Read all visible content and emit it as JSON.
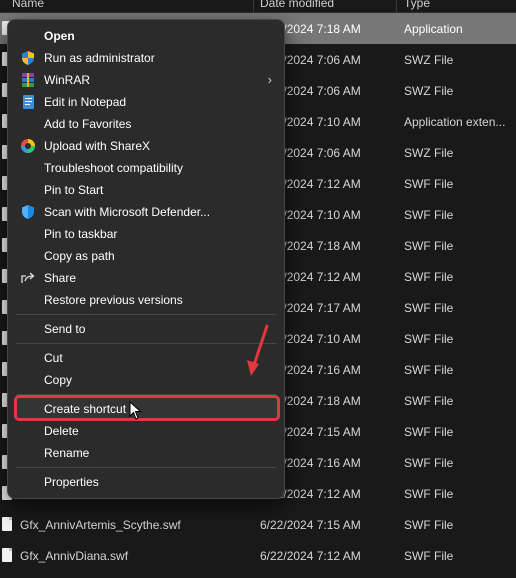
{
  "columns": {
    "name": "Name",
    "date": "Date modified",
    "type": "Type"
  },
  "rows": [
    {
      "name": "",
      "date": "6/22/2024 7:18 AM",
      "type": "Application",
      "selected": true
    },
    {
      "name": "",
      "date": "6/22/2024 7:06 AM",
      "type": "SWZ File"
    },
    {
      "name": "",
      "date": "6/22/2024 7:06 AM",
      "type": "SWZ File"
    },
    {
      "name": "",
      "date": "6/22/2024 7:10 AM",
      "type": "Application exten..."
    },
    {
      "name": "",
      "date": "6/22/2024 7:06 AM",
      "type": "SWZ File"
    },
    {
      "name": "",
      "date": "6/22/2024 7:12 AM",
      "type": "SWF File"
    },
    {
      "name": "",
      "date": "6/22/2024 7:10 AM",
      "type": "SWF File"
    },
    {
      "name": "",
      "date": "6/22/2024 7:18 AM",
      "type": "SWF File"
    },
    {
      "name": "",
      "date": "6/22/2024 7:12 AM",
      "type": "SWF File"
    },
    {
      "name": "",
      "date": "6/22/2024 7:17 AM",
      "type": "SWF File"
    },
    {
      "name": "",
      "date": "6/22/2024 7:10 AM",
      "type": "SWF File"
    },
    {
      "name": "",
      "date": "6/22/2024 7:16 AM",
      "type": "SWF File"
    },
    {
      "name": "",
      "date": "6/22/2024 7:18 AM",
      "type": "SWF File"
    },
    {
      "name": "",
      "date": "6/22/2024 7:15 AM",
      "type": "SWF File"
    },
    {
      "name": "",
      "date": "6/22/2024 7:16 AM",
      "type": "SWF File"
    },
    {
      "name": "",
      "date": "6/22/2024 7:12 AM",
      "type": "SWF File"
    },
    {
      "name": "Gfx_AnnivArtemis_Scythe.swf",
      "date": "6/22/2024 7:15 AM",
      "type": "SWF File"
    },
    {
      "name": "Gfx_AnnivDiana.swf",
      "date": "6/22/2024 7:12 AM",
      "type": "SWF File"
    }
  ],
  "menu": {
    "items": [
      {
        "label": "Open",
        "icon": "none",
        "bold": true
      },
      {
        "label": "Run as administrator",
        "icon": "uac-shield-icon"
      },
      {
        "label": "WinRAR",
        "icon": "winrar-icon",
        "submenu": true
      },
      {
        "label": "Edit in Notepad",
        "icon": "notepad-icon"
      },
      {
        "label": "Add to Favorites",
        "icon": "none"
      },
      {
        "label": "Upload with ShareX",
        "icon": "sharex-icon"
      },
      {
        "label": "Troubleshoot compatibility",
        "icon": "none"
      },
      {
        "label": "Pin to Start",
        "icon": "none"
      },
      {
        "label": "Scan with Microsoft Defender...",
        "icon": "defender-icon"
      },
      {
        "label": "Pin to taskbar",
        "icon": "none"
      },
      {
        "label": "Copy as path",
        "icon": "none"
      },
      {
        "label": "Share",
        "icon": "share-icon"
      },
      {
        "label": "Restore previous versions",
        "icon": "none"
      },
      {
        "label": "Send to",
        "icon": "none",
        "separator_before": true
      },
      {
        "label": "Cut",
        "icon": "none",
        "separator_before": true
      },
      {
        "label": "Copy",
        "icon": "none"
      },
      {
        "label": "Create shortcut",
        "icon": "none",
        "separator_before": true,
        "highlighted": true
      },
      {
        "label": "Delete",
        "icon": "none"
      },
      {
        "label": "Rename",
        "icon": "none"
      },
      {
        "label": "Properties",
        "icon": "none",
        "separator_before": true
      }
    ]
  },
  "colors": {
    "highlight": "#e0383e",
    "background": "#191919",
    "menu_bg": "#2b2b2b"
  }
}
